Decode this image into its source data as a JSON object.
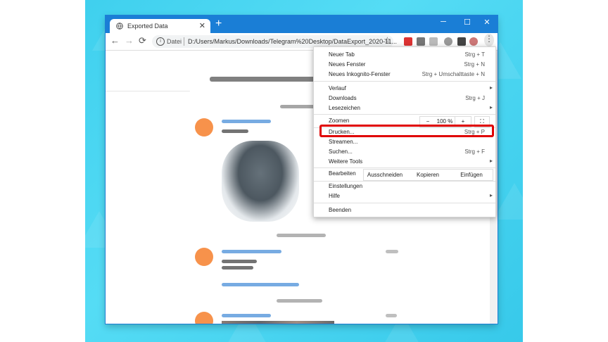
{
  "browser": {
    "tab_title": "Exported Data",
    "tab_close": "✕",
    "new_tab": "+",
    "win_min": "─",
    "win_max": "☐",
    "win_close": "✕",
    "back": "←",
    "forward": "→",
    "reload": "⟳",
    "info": "i",
    "scheme": "Datei",
    "url": "D:/Users/Markus/Downloads/Telegram%20Desktop/DataExport_2020-11...",
    "bookmark": "☆",
    "menu": "⋮"
  },
  "menu": {
    "items": [
      {
        "label": "Neuer Tab",
        "shortcut": "Strg + T"
      },
      {
        "label": "Neues Fenster",
        "shortcut": "Strg + N"
      },
      {
        "label": "Neues Inkognito-Fenster",
        "shortcut": "Strg + Umschalttaste + N"
      },
      {
        "label": "Verlauf",
        "arrow": "▸"
      },
      {
        "label": "Downloads",
        "shortcut": "Strg + J"
      },
      {
        "label": "Lesezeichen",
        "arrow": "▸"
      },
      {
        "label": "Drucken...",
        "shortcut": "Strg + P"
      },
      {
        "label": "Streamen..."
      },
      {
        "label": "Suchen...",
        "shortcut": "Strg + F"
      },
      {
        "label": "Weitere Tools",
        "arrow": "▸"
      },
      {
        "label": "Einstellungen"
      },
      {
        "label": "Hilfe",
        "arrow": "▸"
      },
      {
        "label": "Beenden"
      }
    ],
    "zoom": {
      "label": "Zoomen",
      "minus": "−",
      "value": "100 %",
      "plus": "+",
      "fullscreen": "⛶"
    },
    "edit": {
      "label": "Bearbeiten",
      "cut": "Ausschneiden",
      "copy": "Kopieren",
      "paste": "Einfügen"
    }
  },
  "colors": {
    "accent": "#1a7ed6",
    "highlight": "#e00000",
    "avatar": "#f7924b"
  }
}
